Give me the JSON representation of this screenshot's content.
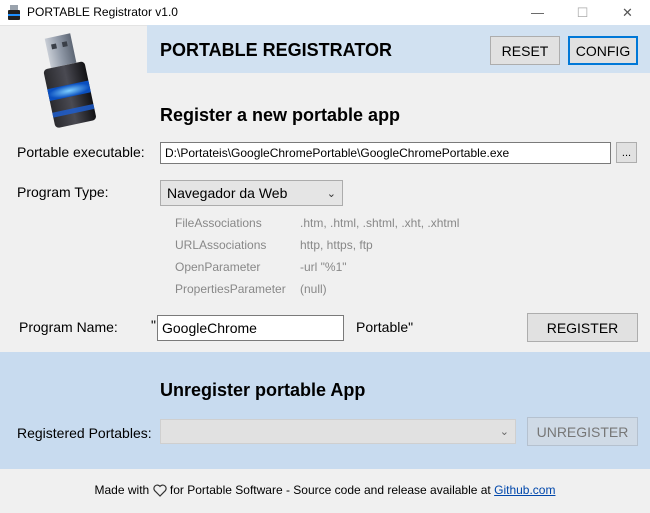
{
  "window": {
    "title": "PORTABLE Registrator v1.0",
    "controls": {
      "minimize": "—",
      "maximize": "☐",
      "close": "✕"
    }
  },
  "header": {
    "title": "PORTABLE REGISTRATOR",
    "reset_label": "RESET",
    "config_label": "CONFIG",
    "logo_icon": "usb-drive-icon"
  },
  "register": {
    "title": "Register a new portable app",
    "exe_label": "Portable executable:",
    "exe_value": "D:\\Portateis\\GoogleChromePortable\\GoogleChromePortable.exe",
    "browse_label": "...",
    "type_label": "Program Type:",
    "type_value": "Navegador da Web",
    "properties": [
      {
        "key": "FileAssociations",
        "value": ".htm, .html, .shtml, .xht, .xhtml"
      },
      {
        "key": "URLAssociations",
        "value": "http, https, ftp"
      },
      {
        "key": "OpenParameter",
        "value": "-url \"%1\""
      },
      {
        "key": "PropertiesParameter",
        "value": "(null)"
      }
    ],
    "name_label": "Program Name:",
    "name_quote_open": "\"",
    "name_value": "GoogleChrome",
    "name_suffix": "Portable\"",
    "register_label": "REGISTER"
  },
  "unregister": {
    "title": "Unregister portable App",
    "registered_label": "Registered Portables:",
    "registered_value": "",
    "unregister_label": "UNREGISTER"
  },
  "footer": {
    "prefix": "Made with",
    "middle": "for Portable Software - Source code and release available at",
    "link": "Github.com"
  },
  "colors": {
    "header_band": "#d1e1f1",
    "bottom_band": "#c8dbef",
    "accent": "#0078d7"
  }
}
